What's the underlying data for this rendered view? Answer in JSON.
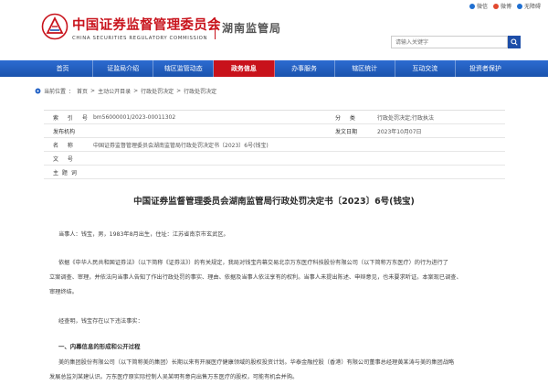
{
  "header": {
    "org_cn": "中国证券监督管理委员会",
    "org_en": "CHINA SECURITIES REGULATORY COMMISSION",
    "bureau": "湖南监管局",
    "toplinks": [
      {
        "label": "微信",
        "icon": "wechat-icon"
      },
      {
        "label": "微博",
        "icon": "weibo-icon"
      },
      {
        "label": "无障碍",
        "icon": "accessibility-icon"
      }
    ],
    "search_placeholder": "请输入关键字"
  },
  "nav": {
    "items": [
      {
        "label": "首页"
      },
      {
        "label": "证监局介绍"
      },
      {
        "label": "辖区监管动态"
      },
      {
        "label": "政务信息",
        "active": true
      },
      {
        "label": "办事服务"
      },
      {
        "label": "辖区统计"
      },
      {
        "label": "互动交流"
      },
      {
        "label": "投资者保护"
      }
    ]
  },
  "breadcrumb": {
    "items": [
      "当前位置",
      "首页",
      "主动公开目录",
      "行政处罚决定",
      "行政处罚决定"
    ]
  },
  "info": {
    "index_label": "索 引 号",
    "index_value": "bm56000001/2023-00011302",
    "category_label": "分 类",
    "category_value": "行政处罚决定;行政执法",
    "publisher_label": "发布机构",
    "publisher_value": "",
    "date_label": "发文日期",
    "date_value": "2023年10月07日",
    "name_label": "名 称",
    "name_value": "中国证券监督管理委员会湖南监管局行政处罚决定书〔2023〕6号(钱宝)",
    "docno_label": "文 号",
    "docno_value": "",
    "subject_label": "主 题 词",
    "subject_value": ""
  },
  "title": "中国证券监督管理委员会湖南监管局行政处罚决定书〔2023〕6号(钱宝)",
  "body": {
    "p1": "当事人：钱宝，男，1983年8月出生，住址：江苏省南京市玄武区。",
    "p2a": "依据《中华人民共和国证券法》（以下简称《证券法》）的有关规定，我局对钱宝内幕交易北京万东医疗科技股份有限公司（以下简称万东医疗）的行为进行了",
    "p2b": "立案调查、审理，并依法向当事人告知了作出行政处罚的事实、理由、依据及当事人依法享有的权利。当事人未提出陈述、申辩意见，也未要求听证。本案现已调查、",
    "p2c": "审理终结。",
    "p3": "经查明，钱宝存在以下违法事实：",
    "h1": "一、内幕信息的形成和公开过程",
    "p4a": "美的集团股份有限公司（以下简称美的集团）长期以来有开展医疗健康领域的股权投资计划。华泰金融控股（香港）有限公司董事总经理黄某涛与美的集团战略",
    "p4b": "发展总监刘某建认识。万东医疗原实际控制人吴某明有意向出售万东医疗的股权，可能有机会并购。"
  },
  "colors": {
    "brand_red": "#c8121b",
    "nav_blue": "#1f5fc4",
    "search_btn": "#1d4ea8"
  }
}
